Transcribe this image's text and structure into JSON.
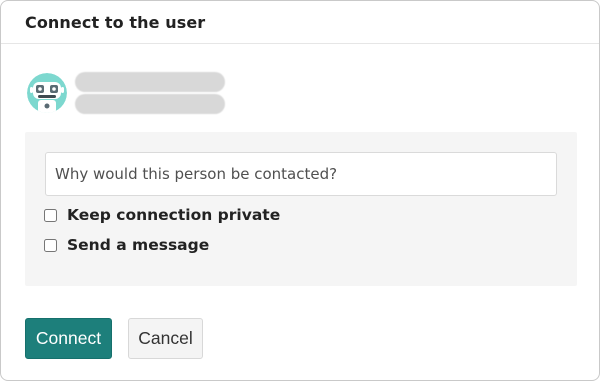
{
  "dialog": {
    "title": "Connect to the user"
  },
  "user": {
    "avatar_icon": "robot-avatar-icon",
    "name_redacted": "",
    "detail_redacted": ""
  },
  "form": {
    "reason_placeholder": "Why would this person be contacted?",
    "reason_value": "",
    "keep_private_label": "Keep connection private",
    "keep_private_checked": false,
    "send_message_label": "Send a message",
    "send_message_checked": false
  },
  "actions": {
    "connect_label": "Connect",
    "cancel_label": "Cancel"
  },
  "colors": {
    "primary": "#1d7f7b",
    "panel_bg": "#f5f5f5",
    "avatar_teal": "#7dd8cf"
  }
}
